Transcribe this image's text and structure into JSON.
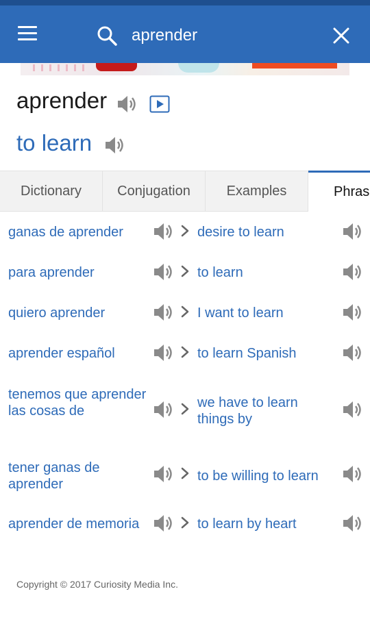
{
  "header": {
    "menu_icon": "hamburger-menu-icon",
    "search_icon": "search-icon",
    "search_value": "aprender",
    "clear_icon": "close-icon",
    "bar_color": "#2e6bb8"
  },
  "entry": {
    "headword": "aprender",
    "translation": "to learn",
    "accent_color": "#2e6bb8"
  },
  "tabs": [
    {
      "label": "Dictionary",
      "active": false
    },
    {
      "label": "Conjugation",
      "active": false
    },
    {
      "label": "Examples",
      "active": false
    },
    {
      "label": "Phrases",
      "active": true
    }
  ],
  "phrases": [
    {
      "es": "ganas de aprender",
      "en": "desire to learn"
    },
    {
      "es": "para aprender",
      "en": "to learn"
    },
    {
      "es": "quiero aprender",
      "en": "I want to learn"
    },
    {
      "es": "aprender español",
      "en": "to learn Spanish"
    },
    {
      "es": "tenemos que aprender las cosas de",
      "en": "we have to learn things by"
    },
    {
      "es": "tener ganas de aprender",
      "en": "to be willing to learn"
    },
    {
      "es": "aprender de memoria",
      "en": "to learn by heart"
    }
  ],
  "footer": {
    "copyright": "Copyright © 2017 Curiosity Media Inc."
  }
}
